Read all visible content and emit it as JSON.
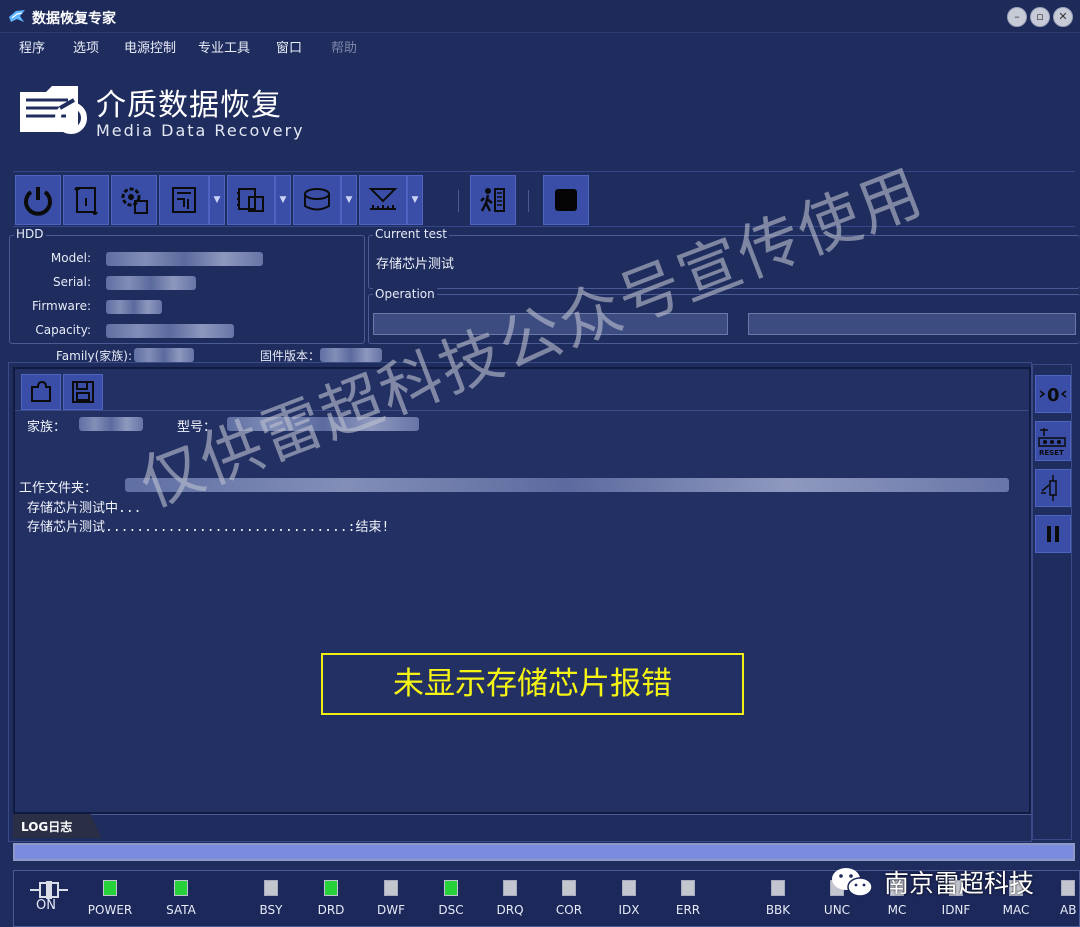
{
  "window": {
    "title": "数据恢复专家",
    "colors": {
      "background": "#1f2c5e",
      "button": "#3a4ea8",
      "led_on": "#28d23a",
      "error_text": "#f6f414"
    }
  },
  "menu": [
    "程序",
    "选项",
    "电源控制",
    "专业工具",
    "窗口",
    "帮助"
  ],
  "logo": {
    "title": "介质数据恢复",
    "subtitle": "Media Data Recovery"
  },
  "toolbar": {
    "buttons": [
      "power-icon",
      "scroll-icon",
      "gear-chip-icon",
      "board-icon",
      "chip-icon",
      "disk-icon",
      "ruler-icon",
      "run-icon",
      "stop-icon"
    ]
  },
  "hdd": {
    "title": "HDD",
    "labels": {
      "model": "Model:",
      "serial": "Serial:",
      "firmware": "Firmware:",
      "capacity": "Capacity:"
    },
    "family_label": "Family(家族):",
    "fw_version_label": "固件版本："
  },
  "current_test": {
    "title": "Current test",
    "value": "存储芯片测试"
  },
  "operation": {
    "title": "Operation"
  },
  "log": {
    "family_label": "家族：",
    "model_label": "型号：",
    "workdir_label": "工作文件夹：",
    "line_testing": "存储芯片测试中...",
    "line_done": "存储芯片测试...............................:结束!",
    "error_banner": "未显示存储芯片报错",
    "tab_label": "LOG日志"
  },
  "progress": {
    "value": 1.0
  },
  "status": {
    "on_label": "ON",
    "leds": [
      {
        "label": "POWER",
        "state": "on"
      },
      {
        "label": "SATA",
        "state": "on"
      },
      {
        "label": "BSY",
        "state": "off"
      },
      {
        "label": "DRD",
        "state": "on"
      },
      {
        "label": "DWF",
        "state": "off"
      },
      {
        "label": "DSC",
        "state": "on"
      },
      {
        "label": "DRQ",
        "state": "off"
      },
      {
        "label": "COR",
        "state": "off"
      },
      {
        "label": "IDX",
        "state": "off"
      },
      {
        "label": "ERR",
        "state": "off"
      },
      {
        "label": "BBK",
        "state": "off"
      },
      {
        "label": "UNC",
        "state": "off"
      },
      {
        "label": "MC",
        "state": "off"
      },
      {
        "label": "IDNF",
        "state": "off"
      },
      {
        "label": "MAC",
        "state": "off"
      },
      {
        "label": "AB",
        "state": "off"
      }
    ]
  },
  "overlay": {
    "watermark": "仅供雷超科技公众号宣传使用",
    "wechat": "南京雷超科技"
  },
  "sidebar": {
    "reset_label": "RESET"
  }
}
